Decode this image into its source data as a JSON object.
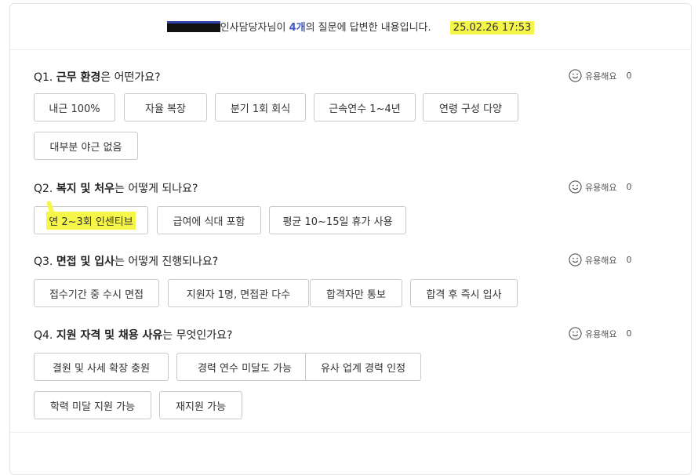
{
  "header": {
    "intro_text": "인사담당자님이",
    "count": "4개",
    "rest_text": "의 질문에 답변한 내용입니다.",
    "datetime": "25.02.26 17:53"
  },
  "helpful_label": "유용해요",
  "questions": [
    {
      "prefix": "Q1. ",
      "bold": "근무 환경",
      "suffix": "은 어떤가요?",
      "helpful_count": "0",
      "answers": [
        "내근 100%",
        "자율 복장",
        "분기 1회 회식",
        "근속연수 1~4년",
        "연령 구성 다양",
        "대부분 야근 없음"
      ]
    },
    {
      "prefix": "Q2. ",
      "bold": "복지 및 처우",
      "suffix": "는 어떻게 되나요?",
      "helpful_count": "0",
      "answers": [
        "연 2~3회 인센티브",
        "급여에 식대 포함",
        "평균 10~15일 휴가 사용"
      ]
    },
    {
      "prefix": "Q3. ",
      "bold": "면접 및 입사",
      "suffix": "는 어떻게 진행되나요?",
      "helpful_count": "0",
      "answers": [
        "접수기간 중 수시 면접",
        "지원자 1명, 면접관 다수",
        "합격자만 통보",
        "합격 후 즉시 입사"
      ]
    },
    {
      "prefix": "Q4. ",
      "bold": "지원 자격 및 채용 사유",
      "suffix": "는 무엇인가요?",
      "helpful_count": "0",
      "answers": [
        "결원 및 사세 확장 충원",
        "경력 연수 미달도 가능",
        "유사 업계 경력 인정",
        "학력 미달 지원 가능",
        "재지원 가능"
      ]
    }
  ]
}
